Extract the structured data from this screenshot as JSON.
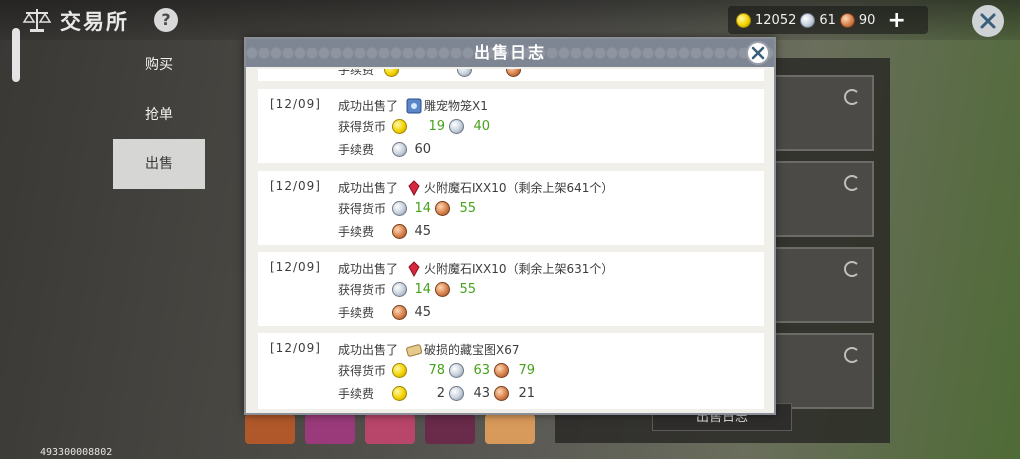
{
  "app": {
    "title": "交易所",
    "help_label": "?",
    "footer_id": "493300008802"
  },
  "currency": {
    "gold": "12052",
    "silver": "61",
    "copper": "90",
    "add_label": "+"
  },
  "sidebar": {
    "tabs": [
      {
        "label": "购买"
      },
      {
        "label": "抢单"
      },
      {
        "label": "出售"
      }
    ]
  },
  "right_panel": {
    "log_button_label": "出售日志"
  },
  "modal": {
    "title": "出售日志",
    "partial_top": {
      "fee_label": "手续费"
    },
    "entries": [
      {
        "date": "[12/09]",
        "action": "成功出售了",
        "item": "雕宠物笼X1",
        "earn_label": "获得货币",
        "earn_gold": "19",
        "earn_silver": "40",
        "fee_label": "手续费",
        "fee_silver": "60"
      },
      {
        "date": "[12/09]",
        "action": "成功出售了",
        "item": "火附魔石ⅨX10（剩余上架641个）",
        "earn_label": "获得货币",
        "earn_silver": "14",
        "earn_copper": "55",
        "fee_label": "手续费",
        "fee_copper": "45"
      },
      {
        "date": "[12/09]",
        "action": "成功出售了",
        "item": "火附魔石ⅨX10（剩余上架631个）",
        "earn_label": "获得货币",
        "earn_silver": "14",
        "earn_copper": "55",
        "fee_label": "手续费",
        "fee_copper": "45"
      },
      {
        "date": "[12/09]",
        "action": "成功出售了",
        "item": "破损的藏宝图X67",
        "earn_label": "获得货币",
        "earn_gold": "78",
        "earn_silver": "63",
        "earn_copper": "79",
        "fee_label": "手续费",
        "fee_gold": "2",
        "fee_silver": "43",
        "fee_copper": "21"
      }
    ]
  }
}
